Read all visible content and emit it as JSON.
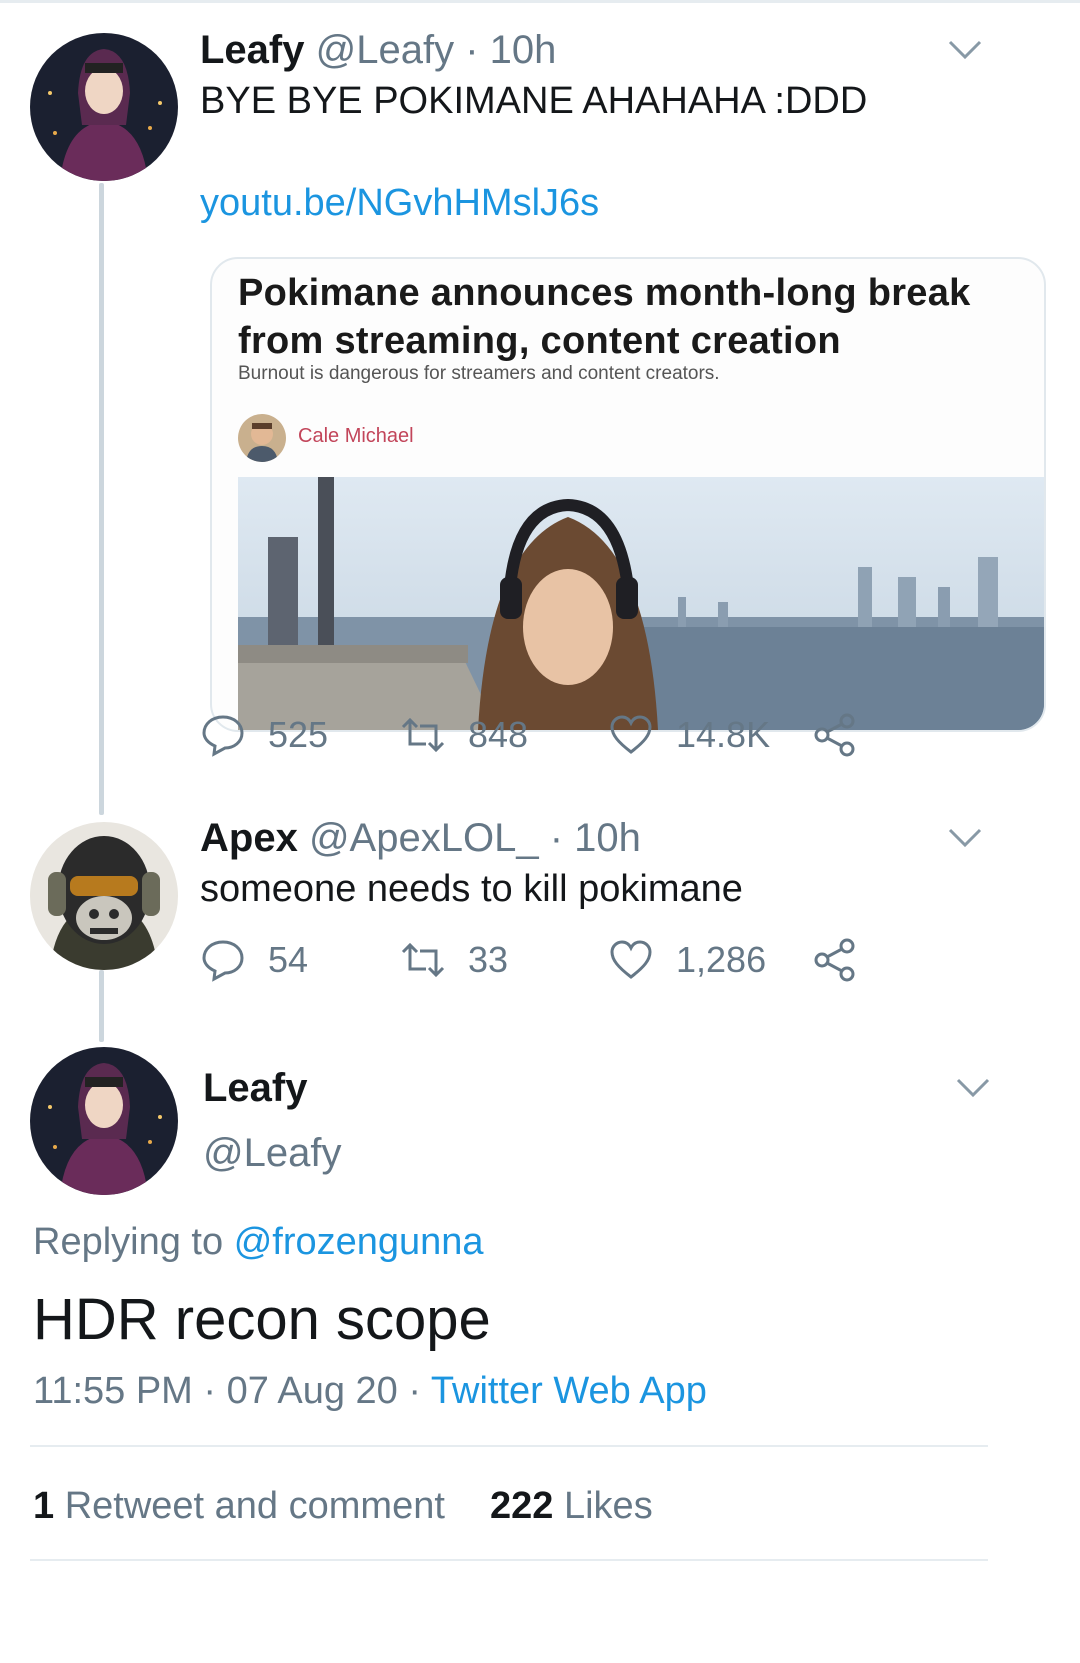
{
  "tweet1": {
    "name": "Leafy",
    "handle": "@Leafy",
    "sep": "·",
    "time": "10h",
    "text": "BYE BYE POKIMANE AHAHAHA :DDD",
    "link": "youtu.be/NGvhHMslJ6s",
    "card": {
      "title": "Pokimane announces month-long break from streaming, content creation",
      "subtitle": "Burnout is dangerous for streamers and content creators.",
      "author": "Cale Michael"
    },
    "actions": {
      "replies": "525",
      "retweets": "848",
      "likes": "14.8K"
    }
  },
  "tweet2": {
    "name": "Apex",
    "handle": "@ApexLOL_",
    "sep": "·",
    "time": "10h",
    "text": "someone needs to kill pokimane",
    "actions": {
      "replies": "54",
      "retweets": "33",
      "likes": "1,286"
    }
  },
  "detail": {
    "name": "Leafy",
    "handle": "@Leafy",
    "replying_prefix": "Replying to",
    "replying_to": "@frozengunna",
    "text": "HDR recon scope",
    "time": "11:55 PM",
    "sep": "·",
    "date": "07 Aug 20",
    "sep2": "·",
    "app": "Twitter Web App",
    "retweets_count": "1",
    "retweets_label": "Retweet and comment",
    "likes_count": "222",
    "likes_label": "Likes"
  },
  "icons": {
    "reply": "reply-icon",
    "retweet": "retweet-icon",
    "like": "heart-icon",
    "share": "share-icon",
    "caret": "chevron-down-icon"
  },
  "colors": {
    "link": "#1b95e0",
    "muted": "#657786",
    "text": "#14171a",
    "thread": "#ccd6dd"
  }
}
